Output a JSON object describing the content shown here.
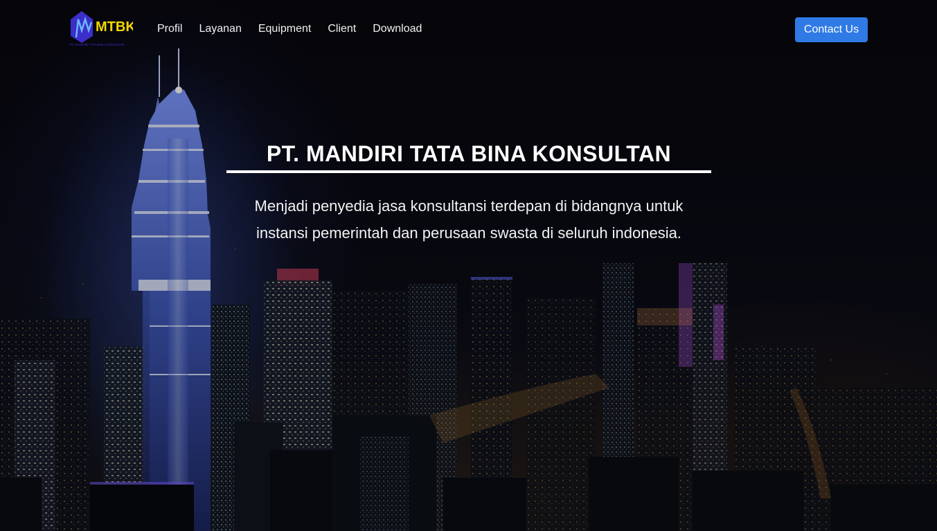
{
  "brand": {
    "logo_text": "MTBK",
    "logo_tagline": "PT. MANDIRI TATA BINA KONSULTAN",
    "primary_color": "#3b2ec9",
    "accent_color": "#f5d800"
  },
  "nav": {
    "items": [
      {
        "label": "Profil"
      },
      {
        "label": "Layanan"
      },
      {
        "label": "Equipment"
      },
      {
        "label": "Client"
      },
      {
        "label": "Download"
      }
    ],
    "contact_label": "Contact Us",
    "contact_color": "#2f7ae5"
  },
  "hero": {
    "title": "PT. MANDIRI TATA BINA KONSULTAN",
    "subtitle": "Menjadi penyedia jasa konsultansi terdepan di bidangnya untuk instansi pemerintah dan perusaan swasta di seluruh indonesia.",
    "background": "night city skyline"
  }
}
